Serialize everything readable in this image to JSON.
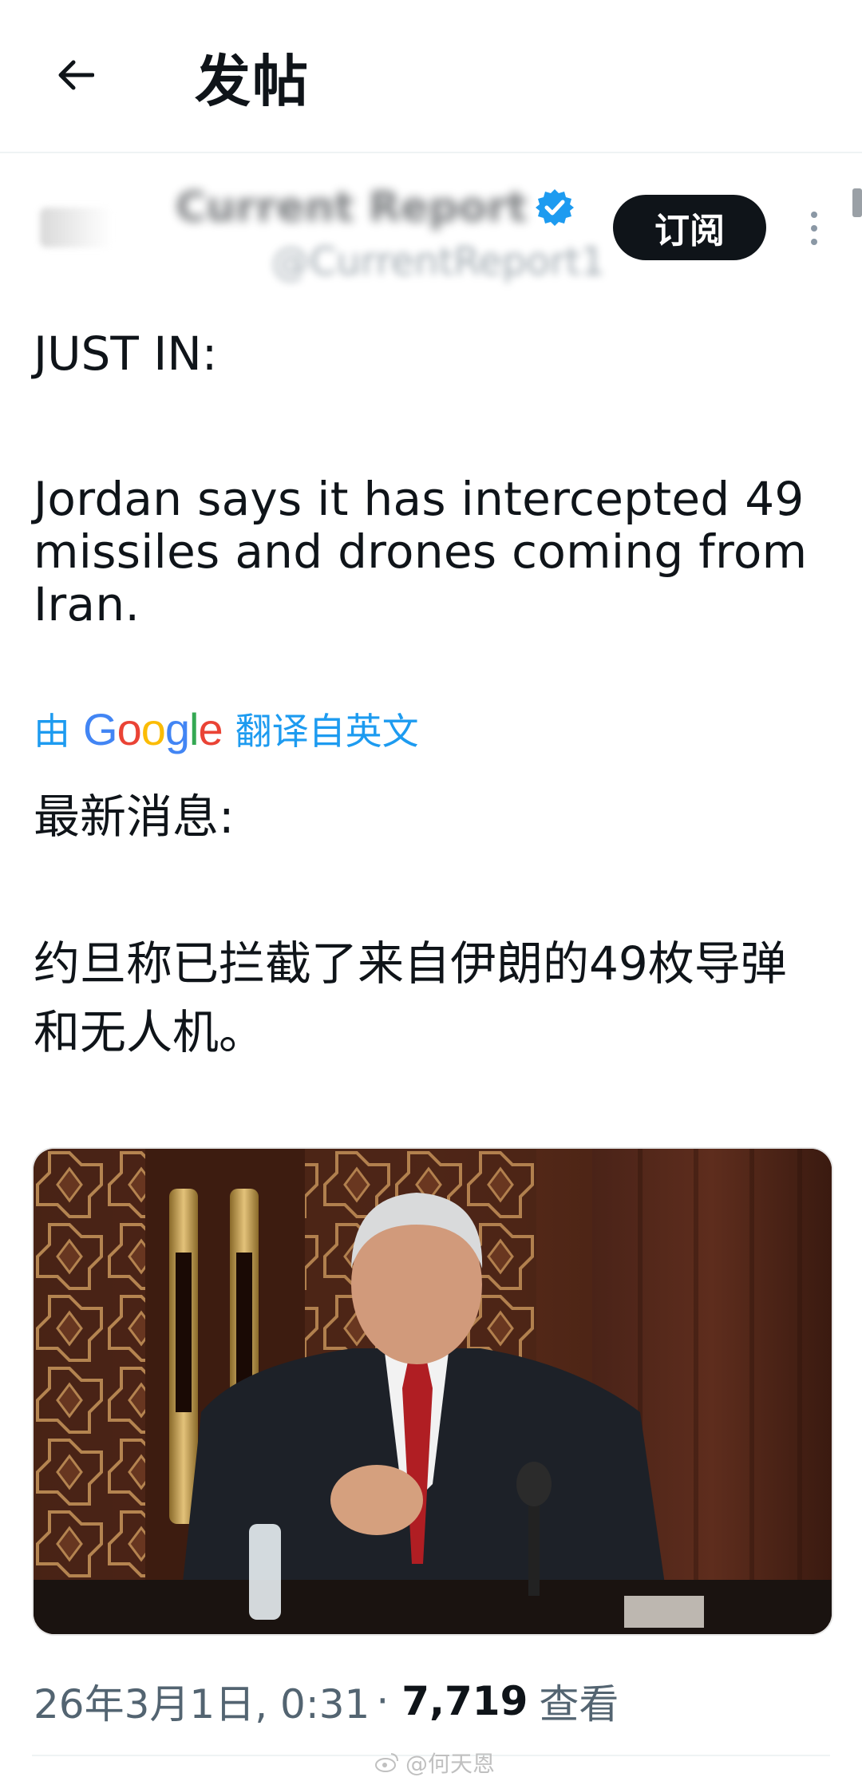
{
  "header": {
    "title": "发帖"
  },
  "author": {
    "display_name": "Current Report",
    "handle": "@CurrentReport1",
    "subscribe_label": "订阅"
  },
  "post": {
    "original_line1": "JUST IN:",
    "original_line2": "Jordan says it has intercepted 49 missiles and drones coming from Iran.",
    "translate_prefix": "由",
    "translate_brand": "Google",
    "translate_suffix": "翻译自英文",
    "translated_line1": "最新消息:",
    "translated_line2": "约旦称已拦截了来自伊朗的49枚导弹和无人机。"
  },
  "meta": {
    "timestamp": "26年3月1日, 0:31",
    "separator": "·",
    "views_count": "7,719",
    "views_label": "查看"
  },
  "watermark": {
    "text": "@何天恩"
  },
  "colors": {
    "accent": "#1d9bf0",
    "text": "#0f1419",
    "secondary": "#536471",
    "button_bg": "#0f1419"
  }
}
